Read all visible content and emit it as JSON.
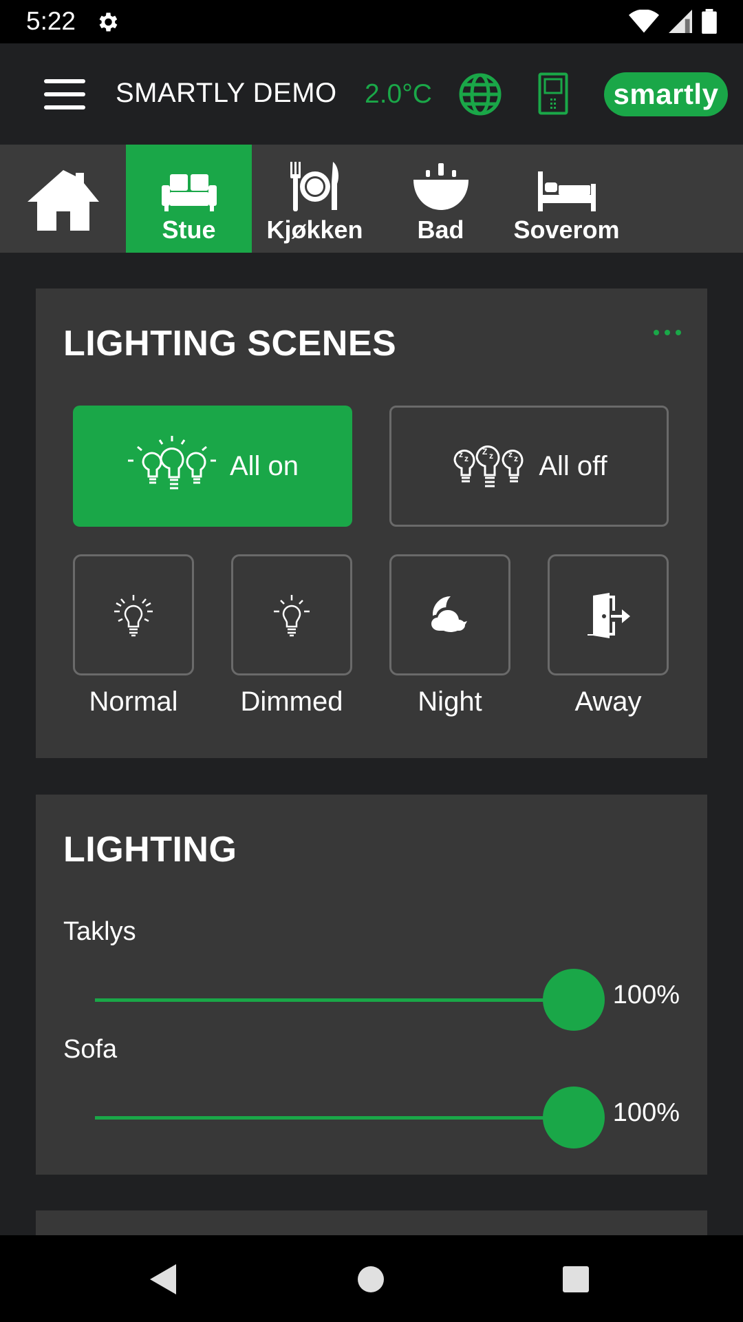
{
  "status_bar": {
    "time": "5:22",
    "icons": [
      "settings-gear-icon",
      "wifi-icon",
      "signal-icon",
      "battery-icon"
    ]
  },
  "app_bar": {
    "menu_icon": "hamburger-menu-icon",
    "title": "SMARTLY DEMO",
    "temperature": "2.0°C",
    "globe_icon": "globe-icon",
    "panel_icon": "wall-panel-icon",
    "logo_text": "smartly"
  },
  "rooms": {
    "home_icon": "home-icon",
    "tabs": [
      {
        "label": "Stue",
        "icon": "sofa-icon",
        "selected": true
      },
      {
        "label": "Kjøkken",
        "icon": "plate-cutlery-icon",
        "selected": false
      },
      {
        "label": "Bad",
        "icon": "sink-icon",
        "selected": false
      },
      {
        "label": "Soverom",
        "icon": "bed-icon",
        "selected": false
      }
    ]
  },
  "lighting_scenes": {
    "title": "LIGHTING SCENES",
    "more_icon": "more-dots-icon",
    "all_on": {
      "label": "All on",
      "icon": "bulbs-on-icon",
      "active": true
    },
    "all_off": {
      "label": "All off",
      "icon": "bulbs-sleeping-icon",
      "active": false
    },
    "scenes": [
      {
        "label": "Normal",
        "icon": "bulb-bright-icon"
      },
      {
        "label": "Dimmed",
        "icon": "bulb-dim-icon"
      },
      {
        "label": "Night",
        "icon": "moon-cloud-icon"
      },
      {
        "label": "Away",
        "icon": "exit-door-icon"
      }
    ]
  },
  "lighting": {
    "title": "LIGHTING",
    "lights": [
      {
        "name": "Taklys",
        "level": 100,
        "level_text": "100%"
      },
      {
        "name": "Sofa",
        "level": 100,
        "level_text": "100%"
      }
    ]
  },
  "nav_bar": {
    "buttons": [
      "back-icon",
      "home-circle-icon",
      "recents-square-icon"
    ]
  },
  "colors": {
    "accent": "#1aa748",
    "background": "#1f2022",
    "card": "#383838",
    "tab_bar": "#3b3b3b"
  }
}
